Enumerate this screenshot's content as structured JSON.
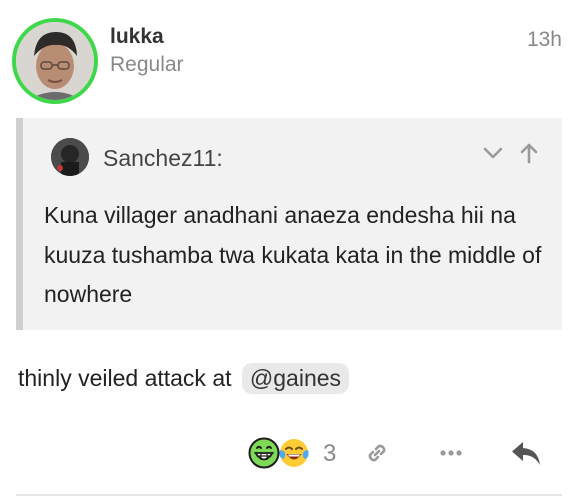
{
  "post": {
    "author": {
      "username": "lukka",
      "title": "Regular",
      "avatar_icon": "user-avatar",
      "flair_color": "#3fd84a"
    },
    "time": "13h",
    "quote": {
      "author": "Sanchez11:",
      "text": "Kuna villager anadhani anaeza endesha hii na kuuza tushamba twa kukata kata in the middle of nowhere",
      "controls": [
        "chevron-down-icon",
        "arrow-up-icon"
      ]
    },
    "body": {
      "text": "thinly veiled attack at",
      "mention": "@gaines"
    },
    "actions": {
      "reactions": [
        "grinning-face-icon",
        "tears-of-joy-face-icon"
      ],
      "reaction_count": "3",
      "buttons": [
        "link-icon",
        "more-icon",
        "reply-icon"
      ]
    }
  }
}
